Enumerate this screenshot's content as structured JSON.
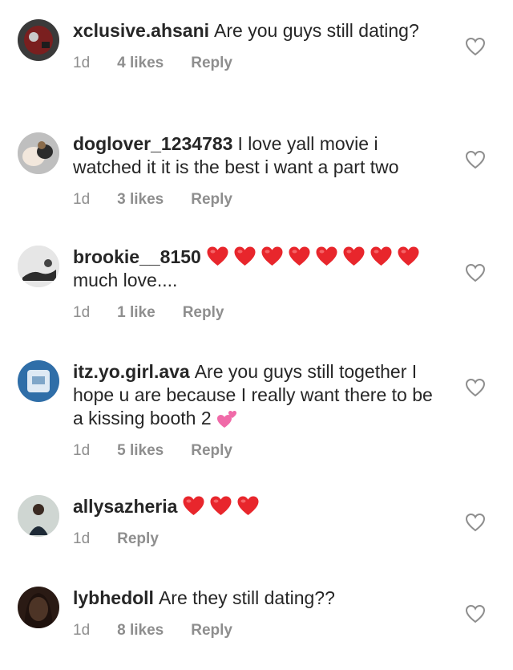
{
  "comments": [
    {
      "username": "xclusive.ahsani",
      "text": "Are you guys still dating?",
      "time": "1d",
      "likes": "4 likes",
      "reply": "Reply"
    },
    {
      "username": "doglover_1234783",
      "text": "I love yall movie i watched it it is the best i want a part two",
      "time": "1d",
      "likes": "3 likes",
      "reply": "Reply"
    },
    {
      "username": "brookie__8150",
      "text": "much love....",
      "time": "1d",
      "likes": "1 like",
      "reply": "Reply"
    },
    {
      "username": "itz.yo.girl.ava",
      "text": "Are you guys still together I hope u are because I really want there to be a kissing booth 2",
      "time": "1d",
      "likes": "5 likes",
      "reply": "Reply"
    },
    {
      "username": "allysazheria",
      "time": "1d",
      "reply": "Reply"
    },
    {
      "username": "lybhedoll",
      "text": "Are they still dating??",
      "time": "1d",
      "likes": "8 likes",
      "reply": "Reply"
    }
  ],
  "colors": {
    "text": "#262626",
    "meta": "#8e8e8e",
    "heart": "#e8262c"
  },
  "icons": {
    "like": "heart-outline-icon",
    "emoji": "red-heart-emoji",
    "sparkle": "sparkling-heart-emoji"
  }
}
